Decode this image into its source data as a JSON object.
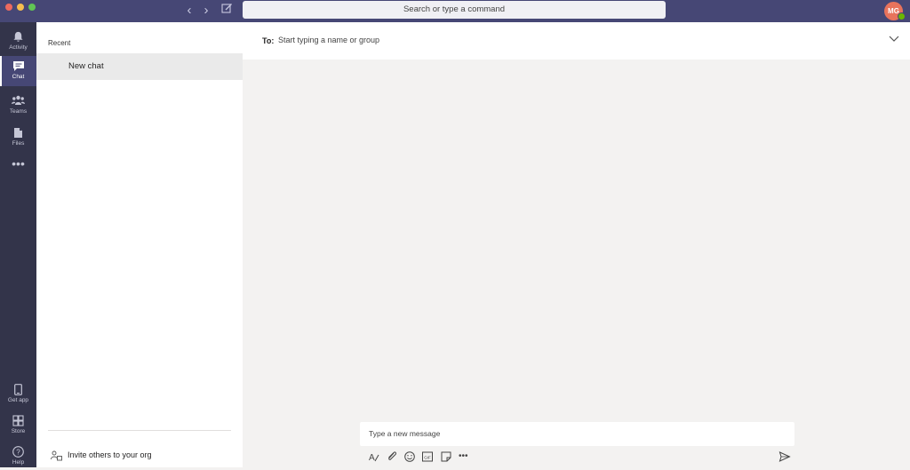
{
  "titlebar": {
    "search_placeholder": "Search or type a command",
    "avatar_initials": "MG",
    "bg_color": "#464775"
  },
  "rail": {
    "items": [
      {
        "label": "Activity",
        "icon": "bell-icon"
      },
      {
        "label": "Chat",
        "icon": "chat-icon",
        "active": true
      },
      {
        "label": "Teams",
        "icon": "teams-icon"
      },
      {
        "label": "Files",
        "icon": "files-icon"
      },
      {
        "label": "",
        "icon": "more-icon"
      }
    ],
    "bottom": [
      {
        "label": "Get app",
        "icon": "phone-icon"
      },
      {
        "label": "Store",
        "icon": "store-icon"
      },
      {
        "label": "Help",
        "icon": "help-icon"
      }
    ]
  },
  "chat_list": {
    "section_title": "Recent",
    "items": [
      {
        "label": "New chat",
        "selected": true
      }
    ],
    "invite_label": "Invite others to your org"
  },
  "main": {
    "to_label": "To:",
    "to_placeholder": "Start typing a name or group",
    "compose_placeholder": "Type a new message",
    "toolbar_icons": [
      "format-icon",
      "attach-icon",
      "emoji-icon",
      "gif-icon",
      "sticker-icon",
      "more-options-icon"
    ],
    "send_icon": "send-icon"
  }
}
